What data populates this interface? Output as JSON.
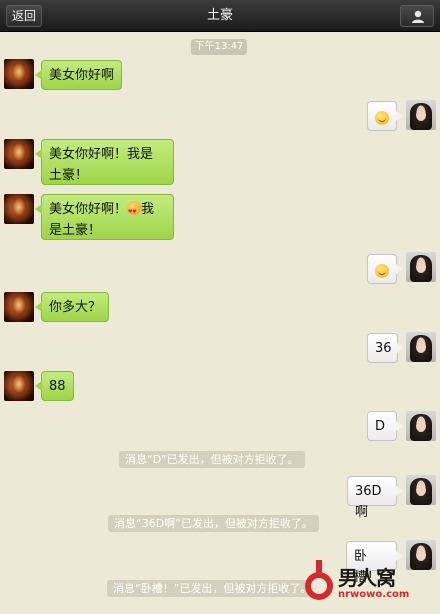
{
  "header": {
    "back_label": "返回",
    "title": "土豪",
    "profile_icon": "person-icon"
  },
  "timestamp": "下午13:47",
  "messages": [
    {
      "side": "left",
      "text": "美女你好啊"
    },
    {
      "side": "right",
      "emoji": "smile-emoji"
    },
    {
      "side": "left",
      "line1": "美女你好啊！我是",
      "line2": "土豪！"
    },
    {
      "side": "left",
      "line1a": "美女你好啊！",
      "emoji": "love-eyes-emoji",
      "line1b": "我",
      "line2": "是土豪！"
    },
    {
      "side": "right",
      "emoji": "smile-emoji"
    },
    {
      "side": "left",
      "text": "你多大？"
    },
    {
      "side": "right",
      "text": "36"
    },
    {
      "side": "left",
      "text": "88"
    },
    {
      "side": "right",
      "text": "D"
    },
    {
      "system": "消息“D”已发出，但被对方拒收了。"
    },
    {
      "side": "right",
      "text": "36D啊"
    },
    {
      "system": "消息“36D啊”已发出，但被对方拒收了。"
    },
    {
      "side": "right",
      "text": "卧槽！"
    },
    {
      "system": "消息“卧槽！”已发出，但被对方拒收了。"
    }
  ],
  "watermark": {
    "brand": "男人窝",
    "url": "nrwowo.com"
  },
  "colors": {
    "background": "#ece9d6",
    "green_bubble": "#a8da55",
    "white_bubble": "#f5f5f5",
    "topbar": "#262626"
  }
}
